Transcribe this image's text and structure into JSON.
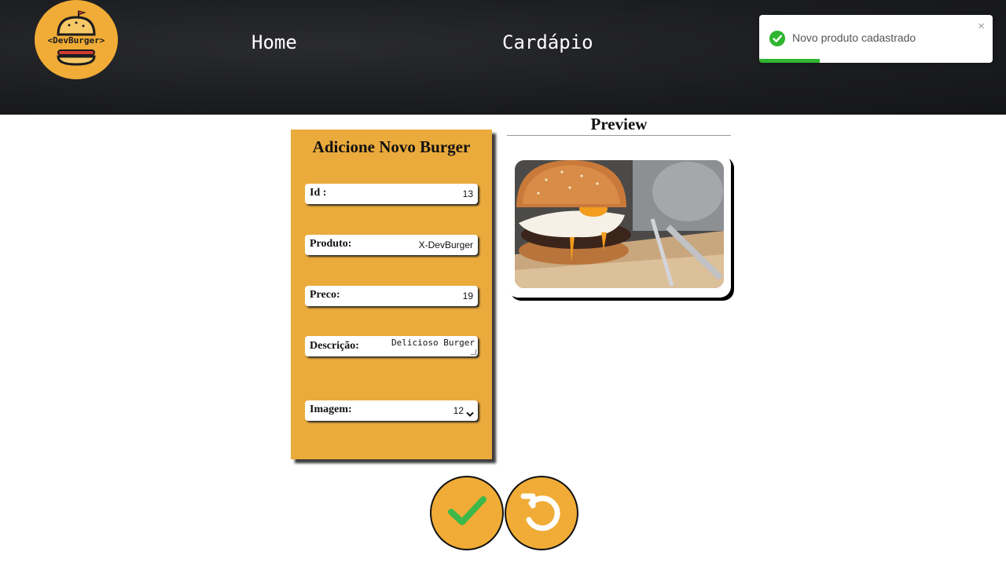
{
  "header": {
    "logo_text": "<DevBurger>",
    "nav": {
      "home": "Home",
      "menu": "Cardápio"
    }
  },
  "toast": {
    "message": "Novo produto cadastrado",
    "close": "×",
    "status_color": "#2fb52f",
    "progress_fraction": 0.26
  },
  "form": {
    "title": "Adicione Novo Burger",
    "fields": {
      "id": {
        "label": "Id :",
        "value": "13"
      },
      "produto": {
        "label": "Produto:",
        "value": "X-DevBurger"
      },
      "preco": {
        "label": "Preco:",
        "value": "19"
      },
      "descricao": {
        "label": "Descrição:",
        "value": "Delicioso Burger"
      },
      "imagem": {
        "label": "Imagem:",
        "value": "12"
      }
    }
  },
  "preview": {
    "title": "Preview"
  },
  "colors": {
    "accent": "#ebab3c",
    "header": "#1b1c1f",
    "success": "#2fb52f"
  },
  "icons": {
    "confirm": "check-icon",
    "reset": "reset-icon"
  }
}
